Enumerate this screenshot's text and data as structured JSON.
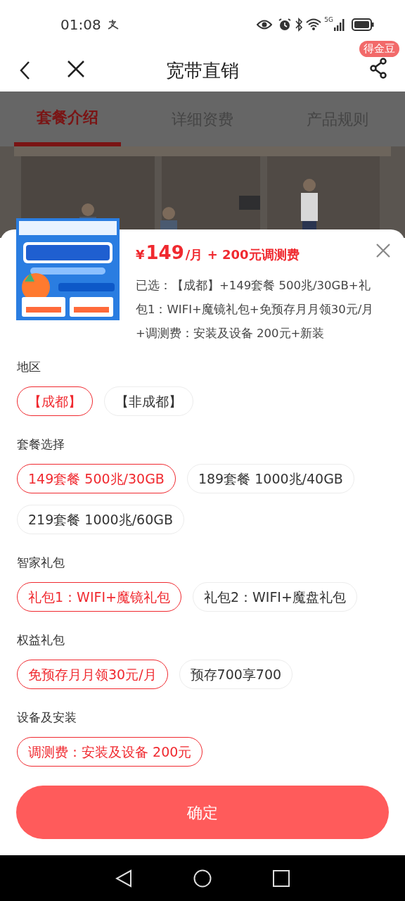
{
  "status_bar": {
    "time": "01:08",
    "network": "5G"
  },
  "nav": {
    "title": "宽带直销",
    "badge": "得金豆"
  },
  "tabs": [
    {
      "label": "套餐介绍",
      "selected": true
    },
    {
      "label": "详细资费",
      "selected": false
    },
    {
      "label": "产品规则",
      "selected": false
    }
  ],
  "sheet": {
    "currency": "¥",
    "price": "149",
    "price_suffix": "/月 + 200元调测费",
    "summary": "已选：【成都】+149套餐 500兆/30GB+礼包1：WIFI+魔镜礼包+免预存月月领30元/月+调测费：安装及设备 200元+新装",
    "groups": [
      {
        "title": "地区",
        "options": [
          {
            "label": "【成都】",
            "selected": true
          },
          {
            "label": "【非成都】",
            "selected": false
          }
        ]
      },
      {
        "title": "套餐选择",
        "options": [
          {
            "label": "149套餐 500兆/30GB",
            "selected": true
          },
          {
            "label": "189套餐 1000兆/40GB",
            "selected": false
          },
          {
            "label": "219套餐 1000兆/60GB",
            "selected": false
          }
        ]
      },
      {
        "title": "智家礼包",
        "options": [
          {
            "label": "礼包1：WIFI+魔镜礼包",
            "selected": true
          },
          {
            "label": "礼包2：WIFI+魔盘礼包",
            "selected": false
          }
        ]
      },
      {
        "title": "权益礼包",
        "options": [
          {
            "label": "免预存月月领30元/月",
            "selected": true
          },
          {
            "label": "预存700享700",
            "selected": false
          }
        ]
      },
      {
        "title": "设备及安装",
        "options": [
          {
            "label": "调测费：安装及设备 200元",
            "selected": true
          }
        ]
      }
    ],
    "confirm": "确定"
  }
}
